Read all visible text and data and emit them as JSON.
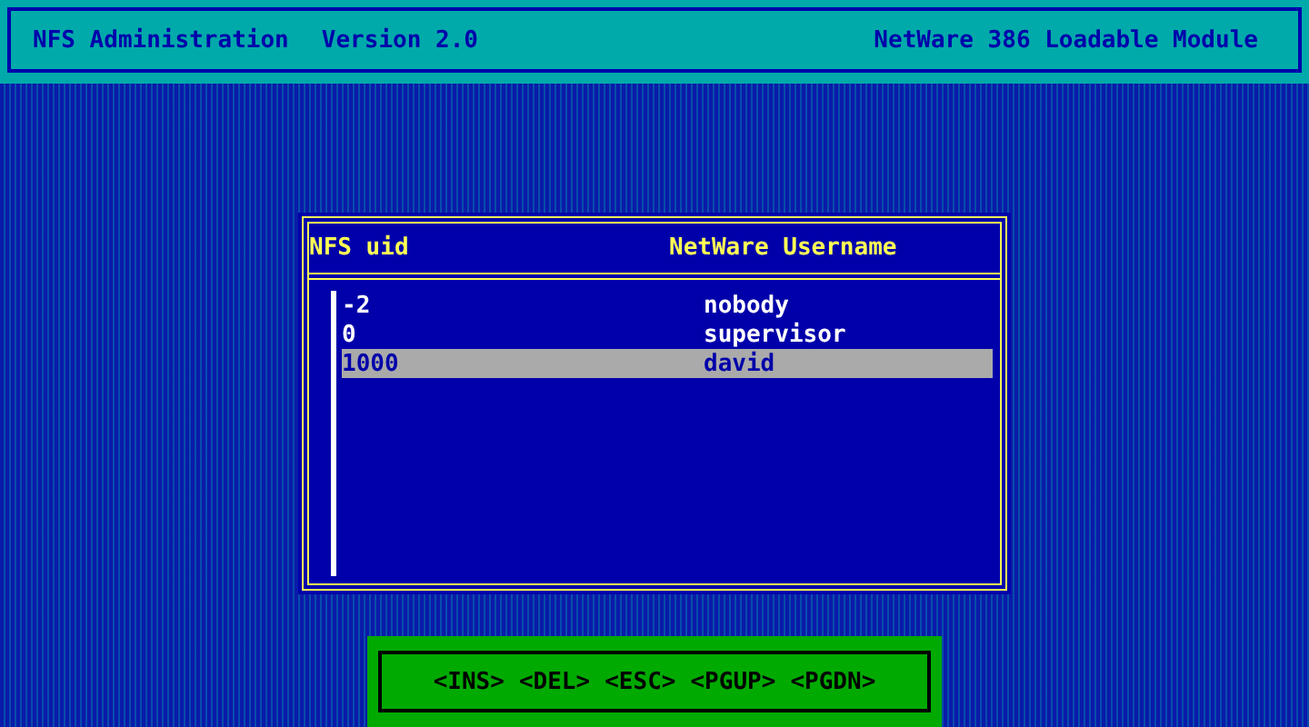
{
  "header": {
    "title": "NFS Administration",
    "version": "Version 2.0",
    "module": "NetWare 386 Loadable Module"
  },
  "table": {
    "columns": [
      "NFS uid",
      "NetWare Username"
    ],
    "rows": [
      {
        "uid": "-2",
        "username": "nobody",
        "selected": false
      },
      {
        "uid": "0",
        "username": "supervisor",
        "selected": false
      },
      {
        "uid": "1000",
        "username": "david",
        "selected": true
      }
    ]
  },
  "keys": [
    "<INS>",
    "<DEL>",
    "<ESC>",
    "<PGUP>",
    "<PGDN>"
  ]
}
